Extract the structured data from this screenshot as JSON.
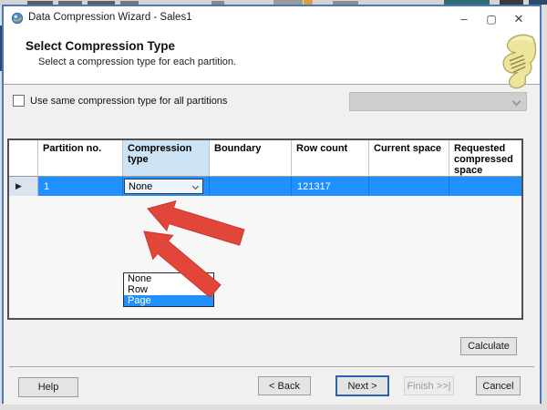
{
  "window": {
    "title": "Data Compression Wizard - Sales1"
  },
  "titlebar_icons": {
    "minimize": "–",
    "maximize": "▢",
    "close": "✕"
  },
  "header": {
    "title": "Select Compression Type",
    "subtitle": "Select a compression type for each partition."
  },
  "options": {
    "checkbox_label": "Use same compression type for all partitions"
  },
  "grid": {
    "columns": [
      "Partition no.",
      "Compression type",
      "Boundary",
      "Row count",
      "Current space",
      "Requested compressed space"
    ],
    "row_selector_glyph": "▶",
    "row": {
      "partition_no": "1",
      "compression_type": "None",
      "boundary": "",
      "row_count": "121317",
      "current_space": "",
      "requested_space": ""
    },
    "dropdown": {
      "options": [
        "None",
        "Row",
        "Page"
      ],
      "highlighted": "Page"
    }
  },
  "buttons": {
    "calculate": "Calculate",
    "help": "Help",
    "back": "< Back",
    "next": "Next >",
    "finish": "Finish >>|",
    "cancel": "Cancel"
  },
  "icons": [
    "wizard-app-icon",
    "minimize-icon",
    "maximize-icon",
    "close-icon",
    "scroll-paper-icon",
    "combo-chevron-icon",
    "row-selector-icon",
    "red-annotation-arrows"
  ],
  "colors": {
    "selection_blue": "#2190ff",
    "window_border_blue": "#4a78b2",
    "header_cell_blue": "#cde4f7",
    "annotation_red": "#e2463a",
    "default_button_border": "#2a64ad"
  }
}
